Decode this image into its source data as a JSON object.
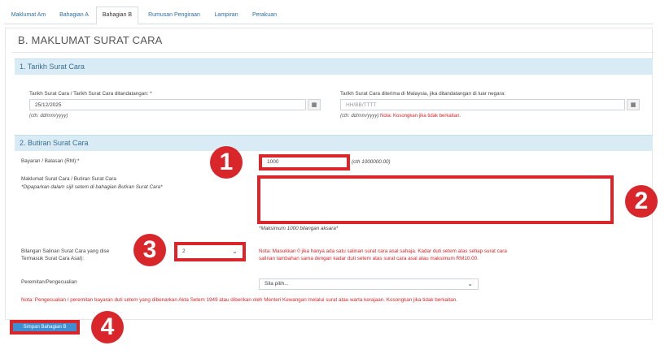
{
  "tabs": [
    {
      "label": "Maklumat Am"
    },
    {
      "label": "Bahagian A"
    },
    {
      "label": "Bahagian B"
    },
    {
      "label": "Rumusan Pengiraan"
    },
    {
      "label": "Lampiran"
    },
    {
      "label": "Perakuan"
    }
  ],
  "page_title": "B. MAKLUMAT SURAT CARA",
  "section1": {
    "title": "1. Tarikh Surat Cara",
    "date_signed": {
      "label": "Tarikh Surat Cara / Tarikh Surat Cara ditandatangan:",
      "required": "*",
      "value": "25/12/2025",
      "hint": "(cth: dd/mm/yyyy)"
    },
    "date_received": {
      "label": "Tarikh Surat Cara diterima di Malaysia, jika ditandatangan di luar negara:",
      "placeholder": "HH/BB/TTTT",
      "hint": "(cth: dd/mm/yyyy)",
      "note": "Nota: Kosongkan jika tidak berkaitan."
    },
    "calendar_icon": "▦"
  },
  "section2": {
    "title": "2. Butiran Surat Cara",
    "payment": {
      "label": "Bayaran / Balasan (RM):*",
      "value": "1000",
      "hint": "(cth 1000000.00)"
    },
    "details": {
      "label": "Maklumat Surat Cara / Butiran Surat Cara",
      "sub": "*Dipaparkan dalam sijil setem di bahagian Butiran Surat Cara*",
      "max": "*Maksimum 1000 bilangan aksara*"
    },
    "copies": {
      "label_line1": "Bilangan Salinan Surat Cara yang dise",
      "label_line2": "Termasuk Surat Cara Asal):",
      "value": "2",
      "note_line1": "Nota: Masukkan 0 jika hanya ada satu salinan surat cara asal sahaja. Kadar duti setem atas setiap surat cara",
      "note_line2": "salinan tambahan sama dengan kadar duti setem atas surat cara asal atau maksimum RM10.00."
    },
    "exemption": {
      "label": "Peremitan/Pengecualian",
      "value": "Sila pilih..."
    },
    "exemption_note": "Nota: Pengecualian / peremitan bayaran duti setem yang dibenarkan Akta Setem 1949 atau diberikan oleh Menteri Kewangan melalui surat atau warta kerajaan. Kosongkan jika tidak berkaitan."
  },
  "save_button": "Simpan Bahagian B",
  "badges": [
    "1",
    "2",
    "3",
    "4"
  ],
  "accent_color": "#d9262b",
  "header_color": "#d9ecf6"
}
